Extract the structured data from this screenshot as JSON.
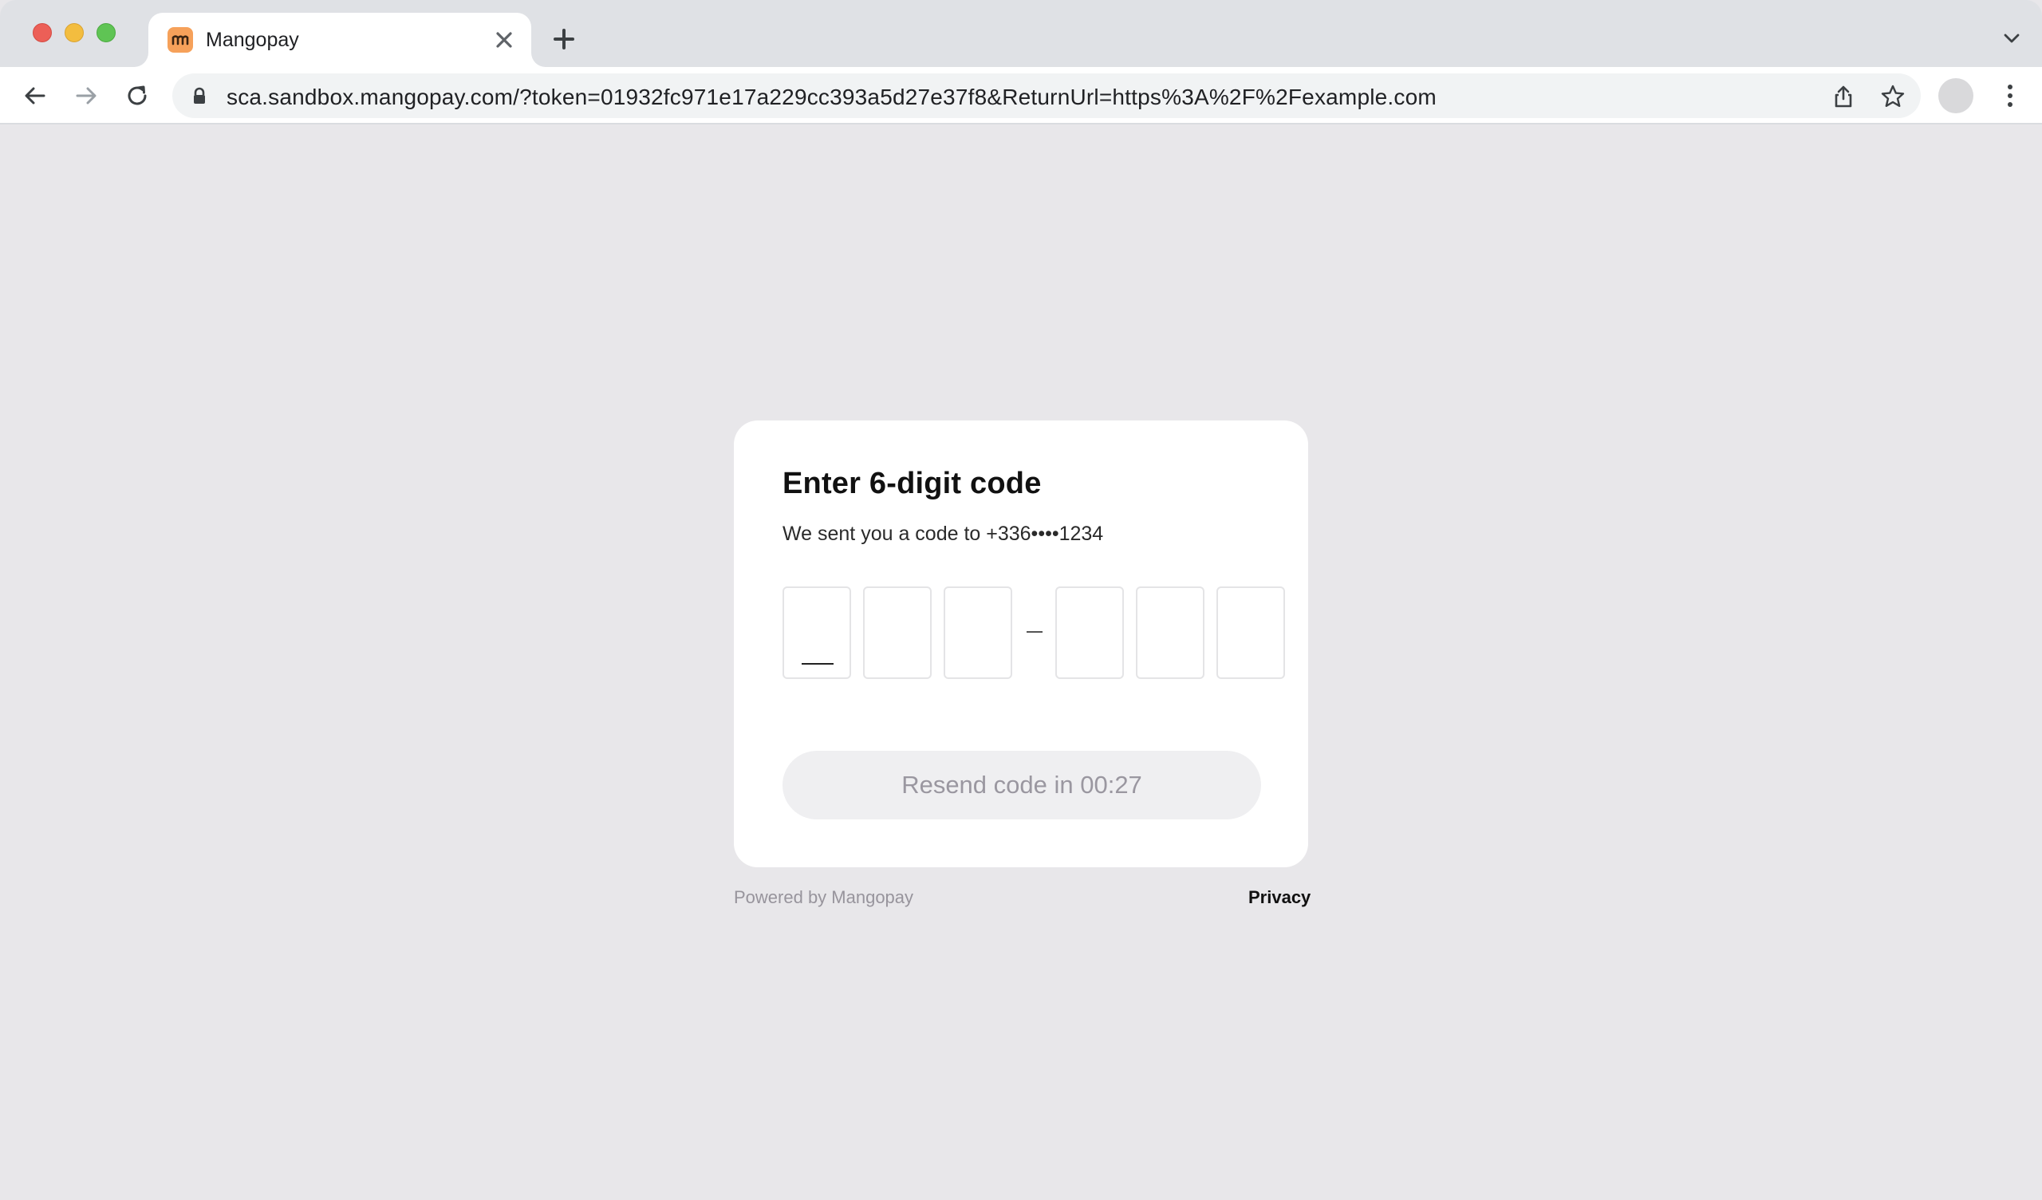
{
  "browser": {
    "tab": {
      "title": "Mangopay",
      "favicon_color": "#f6a15a"
    },
    "address_bar": {
      "url": "sca.sandbox.mangopay.com/?token=01932fc971e17a229cc393a5d27e37f8&ReturnUrl=https%3A%2F%2Fexample.com"
    },
    "icons": [
      "back-icon",
      "forward-icon",
      "reload-icon",
      "lock-icon",
      "share-icon",
      "star-icon",
      "profile-avatar",
      "kebab-menu-icon",
      "close-icon",
      "plus-icon",
      "chevron-down-icon"
    ]
  },
  "verification": {
    "title": "Enter 6-digit code",
    "subtitle": "We sent you a code to +336••••1234",
    "digit_count": 6,
    "resend_label": "Resend code in 00:27"
  },
  "footer": {
    "powered_by": "Powered by Mangopay",
    "privacy": "Privacy"
  },
  "colors": {
    "page_background": "#e8e7ea",
    "card_background": "#ffffff",
    "button_disabled_bg": "#efeff1",
    "button_disabled_text": "#9a97a0"
  }
}
